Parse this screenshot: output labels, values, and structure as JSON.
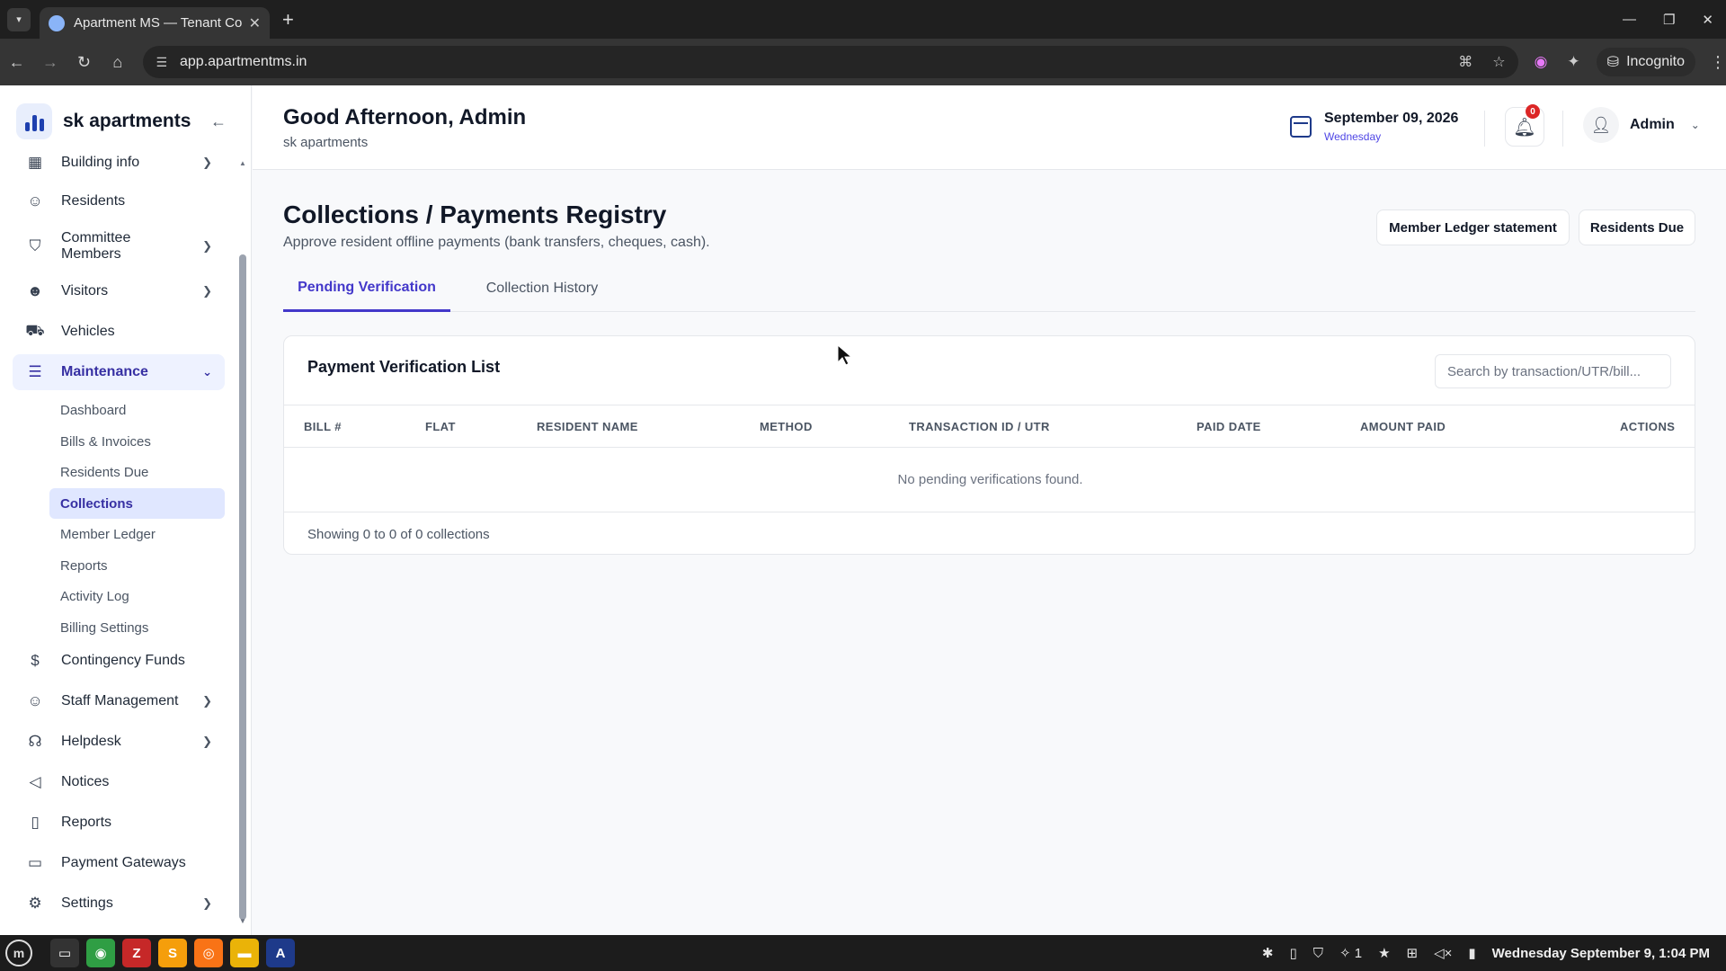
{
  "browser": {
    "tab_title": "Apartment MS — Tenant Co",
    "url": "app.apartmentms.in",
    "profile": "Incognito"
  },
  "sidebar": {
    "brand": "sk apartments",
    "items": [
      {
        "label": "Building info",
        "icon": "grid-icon",
        "has_children": true
      },
      {
        "label": "Residents",
        "icon": "users-icon",
        "has_children": false
      },
      {
        "label": "Committee Members",
        "icon": "shield-icon",
        "has_children": true
      },
      {
        "label": "Visitors",
        "icon": "user-plus-icon",
        "has_children": true
      },
      {
        "label": "Vehicles",
        "icon": "car-icon",
        "has_children": false
      },
      {
        "label": "Maintenance",
        "icon": "server-icon",
        "has_children": true,
        "expanded": true
      }
    ],
    "maintenance_sub": [
      {
        "label": "Dashboard"
      },
      {
        "label": "Bills & Invoices"
      },
      {
        "label": "Residents Due"
      },
      {
        "label": "Collections",
        "active": true
      },
      {
        "label": "Member Ledger"
      },
      {
        "label": "Reports"
      },
      {
        "label": "Activity Log"
      },
      {
        "label": "Billing Settings"
      }
    ],
    "items_after": [
      {
        "label": "Contingency Funds",
        "icon": "dollar-icon",
        "has_children": false
      },
      {
        "label": "Staff Management",
        "icon": "users-icon",
        "has_children": true
      },
      {
        "label": "Helpdesk",
        "icon": "headset-icon",
        "has_children": true
      },
      {
        "label": "Notices",
        "icon": "megaphone-icon",
        "has_children": false
      },
      {
        "label": "Reports",
        "icon": "file-icon",
        "has_children": false
      },
      {
        "label": "Payment Gateways",
        "icon": "card-icon",
        "has_children": false
      },
      {
        "label": "Settings",
        "icon": "gear-icon",
        "has_children": true
      }
    ]
  },
  "header": {
    "greeting": "Good Afternoon, Admin",
    "subtitle": "sk apartments",
    "date": "September 09, 2026",
    "weekday": "Wednesday",
    "notification_count": "0",
    "user": "Admin"
  },
  "page": {
    "title": "Collections / Payments Registry",
    "subtitle": "Approve resident offline payments (bank transfers, cheques, cash).",
    "buttons": {
      "ledger": "Member Ledger statement",
      "due": "Residents Due"
    },
    "tabs": [
      "Pending Verification",
      "Collection History"
    ],
    "card": {
      "title": "Payment Verification List",
      "search_placeholder": "Search by transaction/UTR/bill...",
      "columns": [
        "BILL #",
        "FLAT",
        "RESIDENT NAME",
        "METHOD",
        "TRANSACTION ID / UTR",
        "PAID DATE",
        "AMOUNT PAID",
        "ACTIONS"
      ],
      "empty_text": "No pending verifications found.",
      "footer": "Showing 0 to 0 of 0 collections"
    }
  },
  "taskbar": {
    "clock": "Wednesday September 9, 1:04 PM",
    "tray_count": "1"
  },
  "colors": {
    "accent": "#4338ca",
    "active_bg": "#eef2ff",
    "badge": "#dc2626"
  }
}
